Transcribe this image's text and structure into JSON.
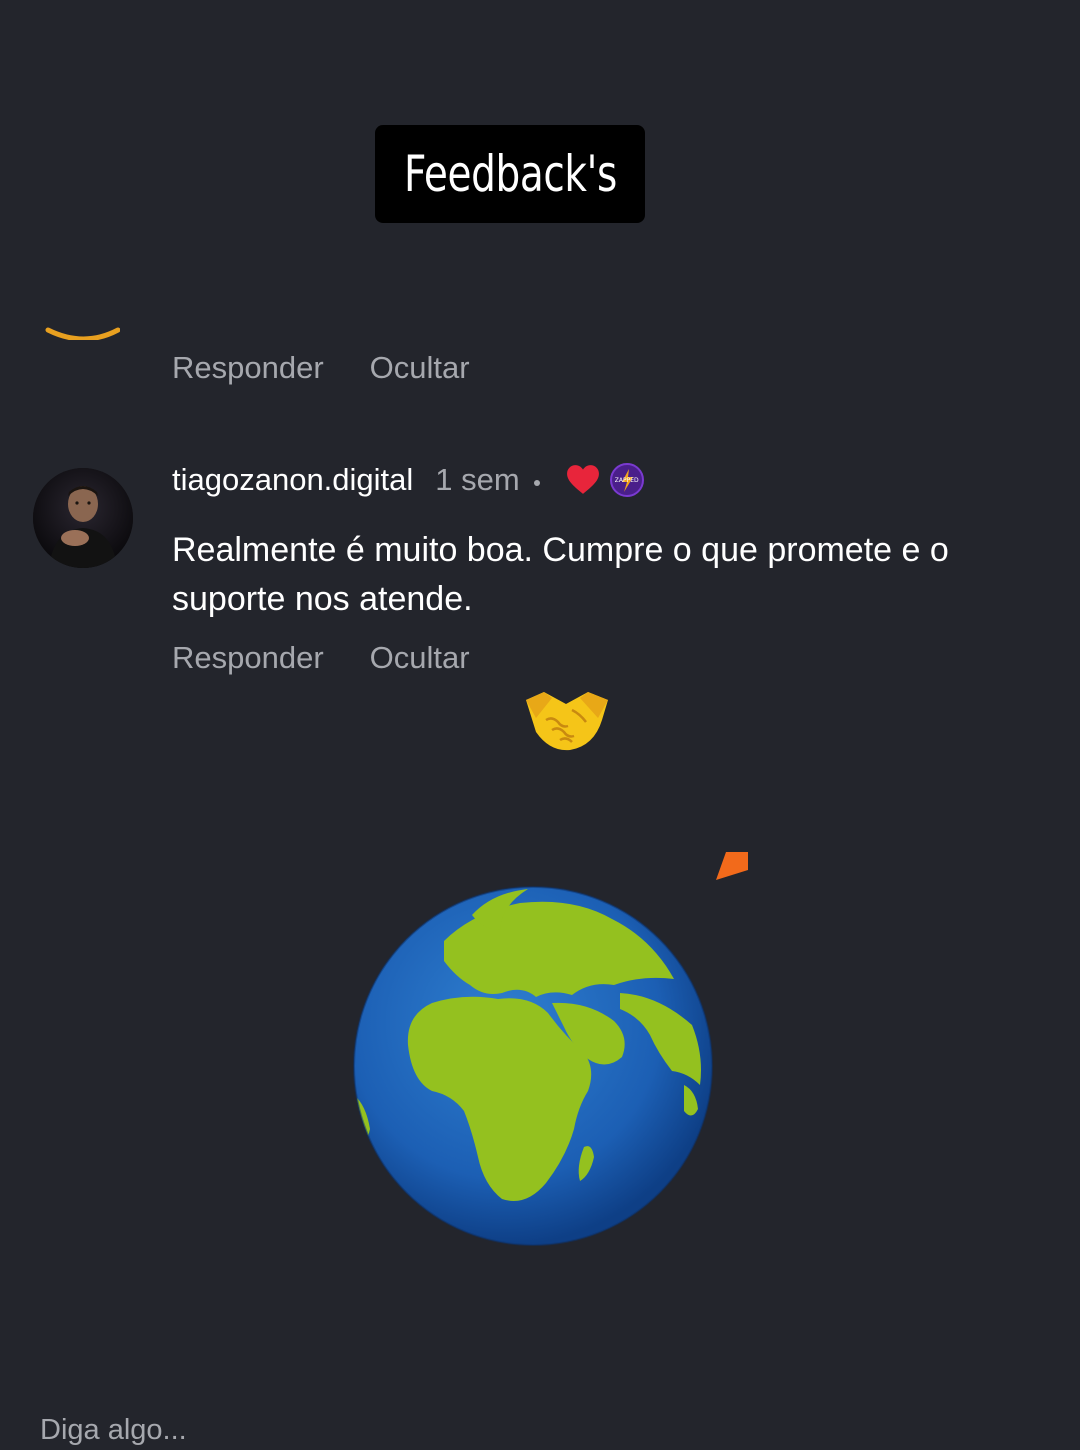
{
  "title": "Feedback's",
  "previous_comment": {
    "reply_label": "Responder",
    "hide_label": "Ocultar"
  },
  "comment": {
    "username": "tiagozanon.digital",
    "time": "1 sem",
    "badge_text": "ZAPPED",
    "text": "Realmente é muito boa. Cumpre o que promete e o suporte nos atende.",
    "reply_label": "Responder",
    "hide_label": "Ocultar"
  },
  "input": {
    "placeholder": "Diga algo..."
  },
  "icons": {
    "handshake": "handshake-icon",
    "globe": "globe-icon",
    "heart": "heart-icon"
  },
  "colors": {
    "background": "#23252c",
    "muted_text": "#a6a8ae",
    "heart": "#e8253b",
    "globe_ocean": "#1c5fb4",
    "globe_land": "#94c11f",
    "accent_orange": "#f26a1b"
  }
}
